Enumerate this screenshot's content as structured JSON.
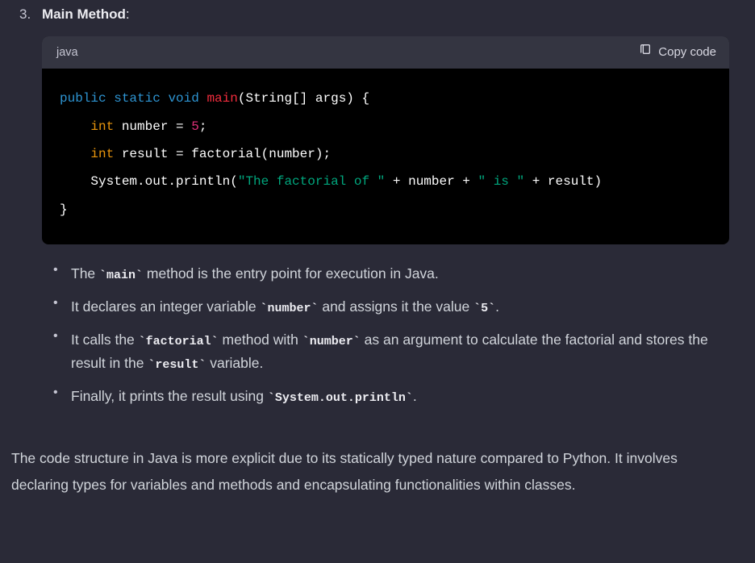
{
  "item": {
    "number": "3.",
    "heading": "Main Method",
    "colon": ":"
  },
  "codeblock": {
    "lang": "java",
    "copy_label": "Copy code",
    "tokens": {
      "public": "public",
      "static": "static",
      "void": "void",
      "main": "main",
      "lparen": "(",
      "String": "String[]",
      "args": " args",
      "rparen": ")",
      "lbrace": " {",
      "int1": "int",
      "number_var": " number = ",
      "five": "5",
      "semi1": ";",
      "int2": "int",
      "result_var": " result = factorial(number);",
      "sysout": "System.out.println(",
      "str1": "\"The factorial of \"",
      "plus1": " + number + ",
      "str2": "\" is \"",
      "plus2": " + result)",
      "rbrace": "}"
    }
  },
  "bullets": [
    {
      "pre": "The ",
      "code": "`main`",
      "post": " method is the entry point for execution in Java."
    },
    {
      "pre": "It declares an integer variable ",
      "code": "`number`",
      "mid": " and assigns it the value ",
      "code2": "`5`",
      "post": "."
    },
    {
      "pre": "It calls the ",
      "code": "`factorial`",
      "mid": " method with ",
      "code2": "`number`",
      "mid2": " as an argument to calculate the factorial and stores the result in the ",
      "code3": "`result`",
      "post": " variable."
    },
    {
      "pre": "Finally, it prints the result using ",
      "code": "`System.out.println`",
      "post": "."
    }
  ],
  "paragraph": "The code structure in Java is more explicit due to its statically typed nature compared to Python. It involves declaring types for variables and methods and encapsulating functionalities within classes."
}
